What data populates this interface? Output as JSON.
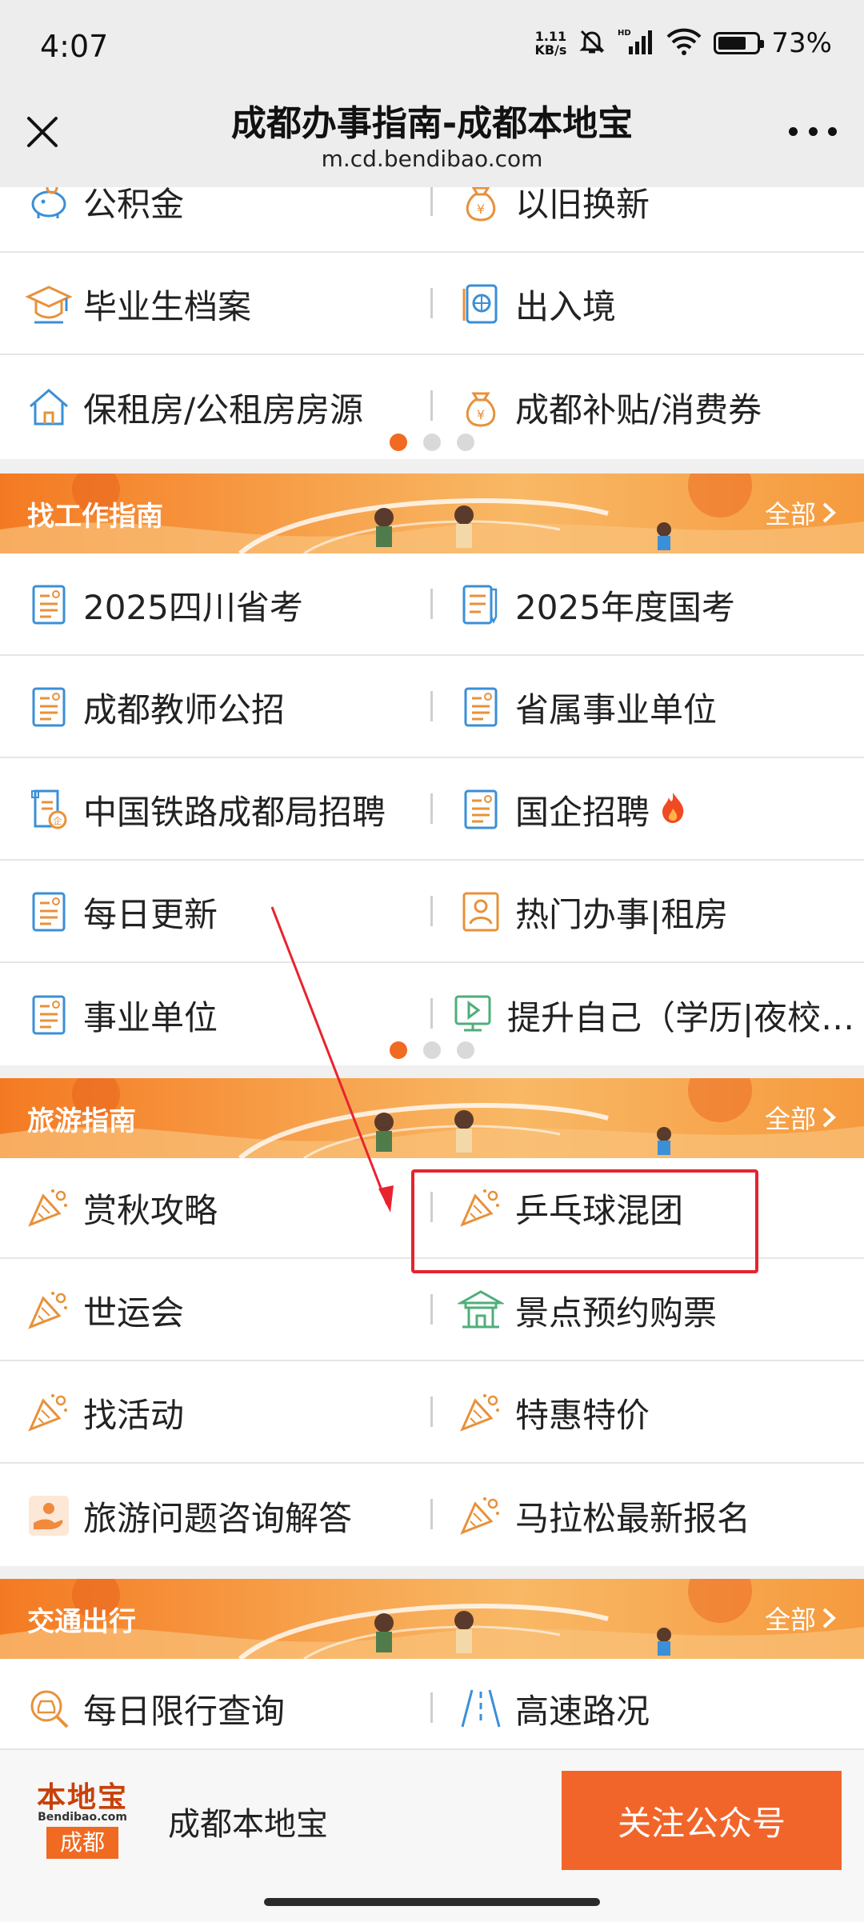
{
  "status_bar": {
    "time": "4:07",
    "net_speed_value": "1.11",
    "net_speed_unit": "KB/s",
    "signal_label": "HD",
    "battery_percent": "73%",
    "battery_level": 0.73
  },
  "top_bar": {
    "title": "成都办事指南-成都本地宝",
    "url": "m.cd.bendibao.com"
  },
  "section_top": {
    "rows": [
      {
        "left": {
          "label": "公积金",
          "icon": "piggy-bank-icon"
        },
        "right": {
          "label": "以旧换新",
          "icon": "money-bag-icon"
        }
      },
      {
        "left": {
          "label": "毕业生档案",
          "icon": "graduation-cap-icon"
        },
        "right": {
          "label": "出入境",
          "icon": "passport-icon"
        }
      },
      {
        "left": {
          "label": "保租房/公租房房源",
          "icon": "house-icon"
        },
        "right": {
          "label": "成都补贴/消费券",
          "icon": "money-bag-icon"
        }
      }
    ]
  },
  "section_jobs": {
    "title": "找工作指南",
    "all_label": "全部",
    "rows": [
      {
        "left": {
          "label": "2025四川省考",
          "icon": "document-person-icon"
        },
        "right": {
          "label": "2025年度国考",
          "icon": "document-pen-icon"
        }
      },
      {
        "left": {
          "label": "成都教师公招",
          "icon": "document-person-icon"
        },
        "right": {
          "label": "省属事业单位",
          "icon": "document-person-icon"
        }
      },
      {
        "left": {
          "label": "中国铁路成都局招聘",
          "icon": "enterprise-document-icon"
        },
        "right": {
          "label": "国企招聘",
          "icon": "document-person-icon",
          "badge": "fire-icon"
        }
      },
      {
        "left": {
          "label": "每日更新",
          "icon": "document-person-icon"
        },
        "right": {
          "label": "热门办事|租房",
          "icon": "person-card-icon"
        }
      },
      {
        "left": {
          "label": "事业单位",
          "icon": "document-person-icon"
        },
        "right": {
          "label": "提升自己（学历|夜校…",
          "icon": "video-lesson-icon"
        }
      }
    ]
  },
  "section_travel": {
    "title": "旅游指南",
    "all_label": "全部",
    "rows": [
      {
        "left": {
          "label": "赏秋攻略",
          "icon": "party-popper-icon"
        },
        "right": {
          "label": "乒乓球混团",
          "icon": "party-popper-icon"
        }
      },
      {
        "left": {
          "label": "世运会",
          "icon": "party-popper-icon"
        },
        "right": {
          "label": "景点预约购票",
          "icon": "pavilion-icon"
        }
      },
      {
        "left": {
          "label": "找活动",
          "icon": "party-popper-icon"
        },
        "right": {
          "label": "特惠特价",
          "icon": "party-popper-icon"
        }
      },
      {
        "left": {
          "label": "旅游问题咨询解答",
          "icon": "hand-service-icon"
        },
        "right": {
          "label": "马拉松最新报名",
          "icon": "party-popper-icon"
        }
      }
    ]
  },
  "section_traffic": {
    "title": "交通出行",
    "all_label": "全部",
    "rows": [
      {
        "left": {
          "label": "每日限行查询",
          "icon": "car-search-icon"
        },
        "right": {
          "label": "高速路况",
          "icon": "road-icon"
        }
      }
    ]
  },
  "bottom_bar": {
    "logo_top": "本地宝",
    "logo_mid": "Bendibao.com",
    "logo_bottom": "成都",
    "brand_name": "成都本地宝",
    "follow_label": "关注公众号"
  },
  "colors": {
    "accent": "#f06a21",
    "highlight": "#e8232e",
    "icon_orange": "#e8913a",
    "icon_blue": "#3b8fd6"
  }
}
